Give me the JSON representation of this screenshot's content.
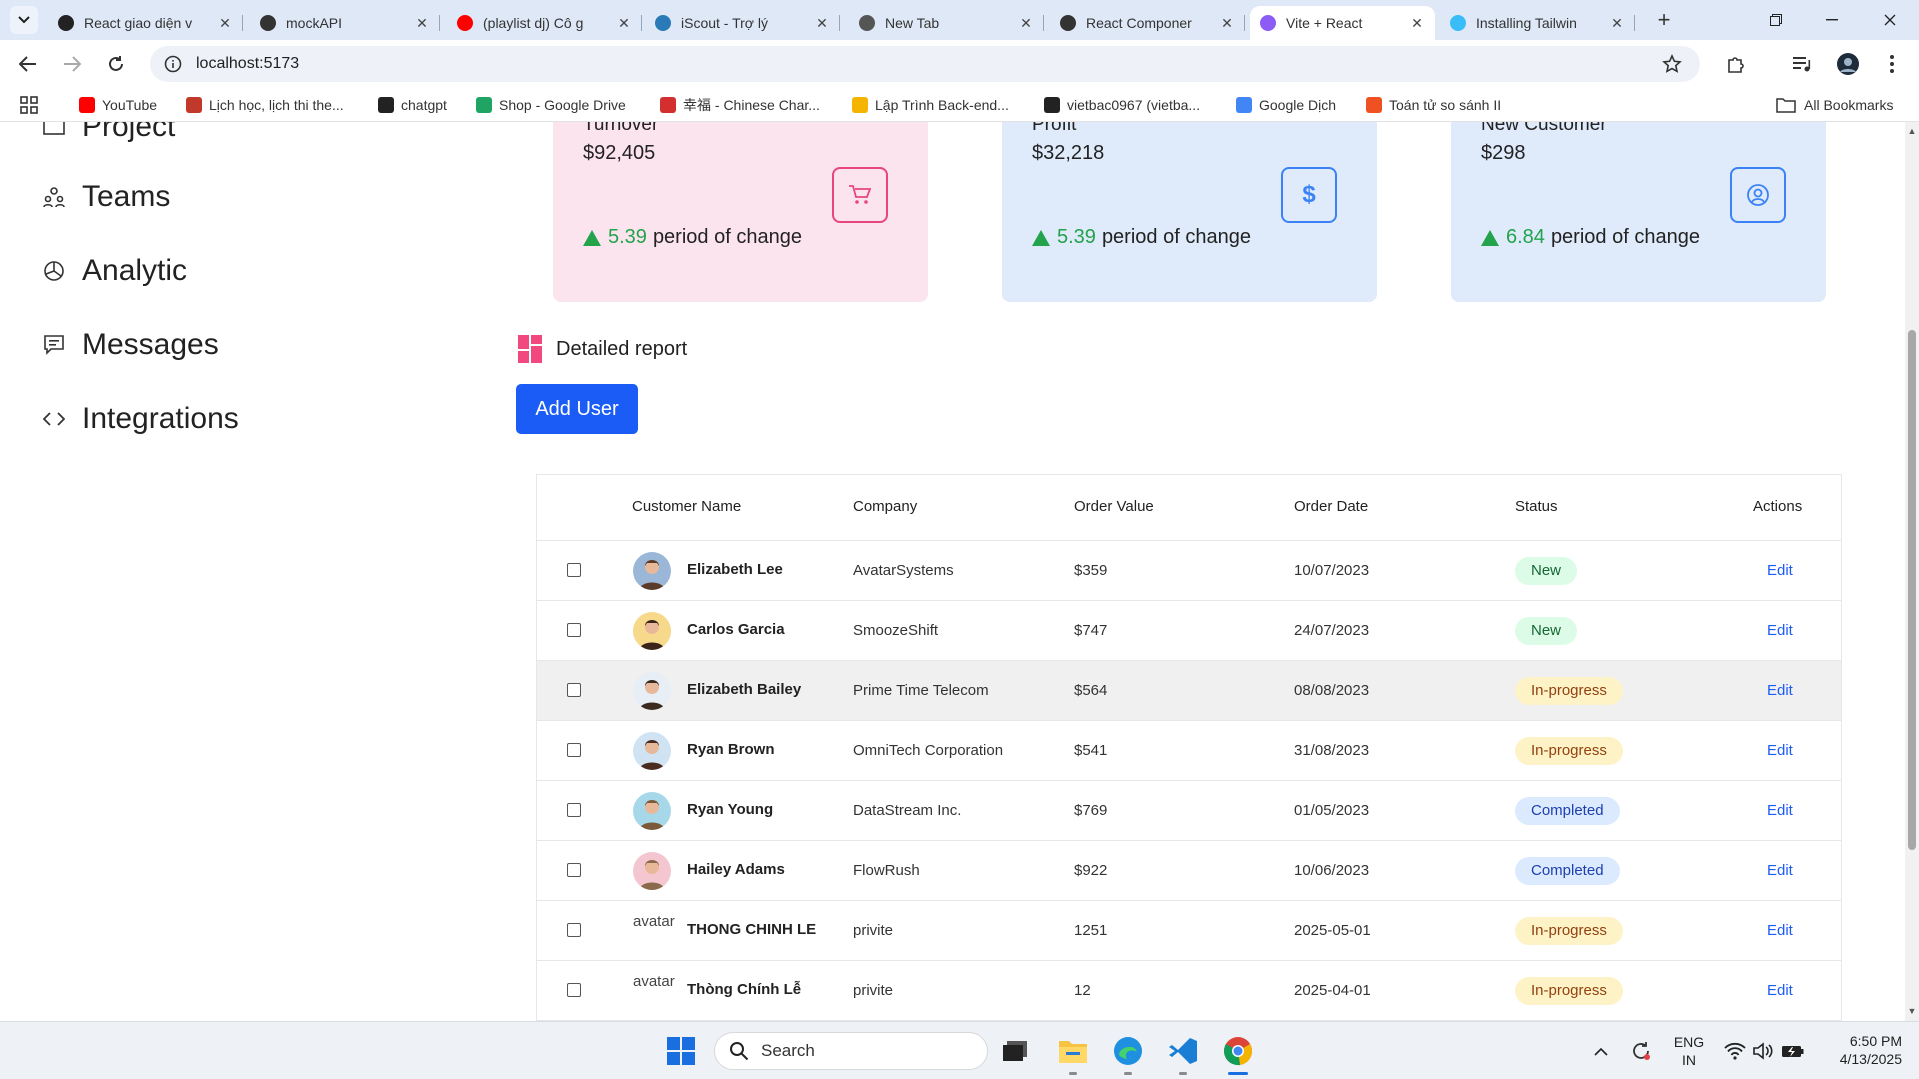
{
  "browser": {
    "tabs": [
      {
        "label": "React giao diện v",
        "icon": "globe-icon",
        "color": "#222222"
      },
      {
        "label": "mockAPI",
        "icon": "mockapi-icon",
        "color": "#333333"
      },
      {
        "label": "(playlist dj) Cô g",
        "icon": "youtube-icon",
        "color": "#ff0000"
      },
      {
        "label": "iScout - Trợ lý",
        "icon": "iscout-icon",
        "color": "#2a7ab8"
      },
      {
        "label": "New Tab",
        "icon": "chrome-icon",
        "color": "#555555"
      },
      {
        "label": "React Componer",
        "icon": "react-icon",
        "color": "#333333"
      },
      {
        "label": "Vite + React",
        "icon": "vite-icon",
        "color": "#8b5cf6"
      },
      {
        "label": "Installing Tailwin",
        "icon": "tailwind-icon",
        "color": "#38bdf8"
      }
    ],
    "url": "localhost:5173",
    "bookmarks": [
      {
        "label": "YouTube",
        "icon": "youtube-icon",
        "color": "#ff0000"
      },
      {
        "label": "Lịch học, lịch thi the...",
        "icon": "school-icon",
        "color": "#c0392b"
      },
      {
        "label": "chatgpt",
        "icon": "chatgpt-icon",
        "color": "#222222"
      },
      {
        "label": "Shop - Google Drive",
        "icon": "drive-icon",
        "color": "#1fa463"
      },
      {
        "label": "幸福 - Chinese Char...",
        "icon": "chinese-char-icon",
        "color": "#d32f2f"
      },
      {
        "label": "Lập Trình Back-end...",
        "icon": "drive-icon",
        "color": "#f4b400"
      },
      {
        "label": "vietbac0967 (vietba...",
        "icon": "github-icon",
        "color": "#222222"
      },
      {
        "label": "Google Dịch",
        "icon": "translate-icon",
        "color": "#4285f4"
      },
      {
        "label": "Toán tử so sánh II",
        "icon": "f8-icon",
        "color": "#f05123"
      }
    ],
    "all_bookmarks": "All Bookmarks"
  },
  "sidebar": {
    "items": [
      {
        "label": "Project",
        "icon": "folder-icon"
      },
      {
        "label": "Teams",
        "icon": "teams-icon"
      },
      {
        "label": "Analytic",
        "icon": "pie-chart-icon"
      },
      {
        "label": "Messages",
        "icon": "message-icon"
      },
      {
        "label": "Integrations",
        "icon": "code-icon"
      }
    ]
  },
  "cards": [
    {
      "title": "Turnover",
      "value": "$92,405",
      "change": "5.39",
      "change_text": "period of change",
      "icon": "cart-icon",
      "bg": "#fce4ef",
      "accent": "#e8457d"
    },
    {
      "title": "Profit",
      "value": "$32,218",
      "change": "5.39",
      "change_text": "period of change",
      "icon": "dollar-icon",
      "bg": "#dfeafb",
      "accent": "#3b82f6"
    },
    {
      "title": "New Customer",
      "value": "$298",
      "change": "6.84",
      "change_text": "period of change",
      "icon": "user-circle-icon",
      "bg": "#dfeafb",
      "accent": "#3b82f6"
    }
  ],
  "report": {
    "title": "Detailed report",
    "add_user_label": "Add User"
  },
  "table": {
    "headers": [
      "Customer Name",
      "Company",
      "Order Value",
      "Order Date",
      "Status",
      "Actions"
    ],
    "rows": [
      {
        "name": "Elizabeth Lee",
        "company": "AvatarSystems",
        "value": "$359",
        "date": "10/07/2023",
        "status": "New",
        "status_kind": "new",
        "action": "Edit",
        "avatar": "avatar-man-1"
      },
      {
        "name": "Carlos Garcia",
        "company": "SmoozeShift",
        "value": "$747",
        "date": "24/07/2023",
        "status": "New",
        "status_kind": "new",
        "action": "Edit",
        "avatar": "avatar-woman-1"
      },
      {
        "name": "Elizabeth Bailey",
        "company": "Prime Time Telecom",
        "value": "$564",
        "date": "08/08/2023",
        "status": "In-progress",
        "status_kind": "inprogress",
        "action": "Edit",
        "avatar": "avatar-man-2"
      },
      {
        "name": "Ryan Brown",
        "company": "OmniTech Corporation",
        "value": "$541",
        "date": "31/08/2023",
        "status": "In-progress",
        "status_kind": "inprogress",
        "action": "Edit",
        "avatar": "avatar-woman-2"
      },
      {
        "name": "Ryan Young",
        "company": "DataStream Inc.",
        "value": "$769",
        "date": "01/05/2023",
        "status": "Completed",
        "status_kind": "completed",
        "action": "Edit",
        "avatar": "avatar-man-3"
      },
      {
        "name": "Hailey Adams",
        "company": "FlowRush",
        "value": "$922",
        "date": "10/06/2023",
        "status": "Completed",
        "status_kind": "completed",
        "action": "Edit",
        "avatar": "avatar-man-4"
      },
      {
        "name": "THONG CHINH LE",
        "company": "privite",
        "value": "1251",
        "date": "2025-05-01",
        "status": "In-progress",
        "status_kind": "inprogress",
        "action": "Edit",
        "avatar": "broken-image",
        "alt": "avatar"
      },
      {
        "name": "Thòng Chính Lễ",
        "company": "privite",
        "value": "12",
        "date": "2025-04-01",
        "status": "In-progress",
        "status_kind": "inprogress",
        "action": "Edit",
        "avatar": "broken-image",
        "alt": "avatar"
      }
    ]
  },
  "taskbar": {
    "search_label": "Search",
    "language": "ENG",
    "region": "IN",
    "time": "6:50 PM",
    "date": "4/13/2025"
  }
}
